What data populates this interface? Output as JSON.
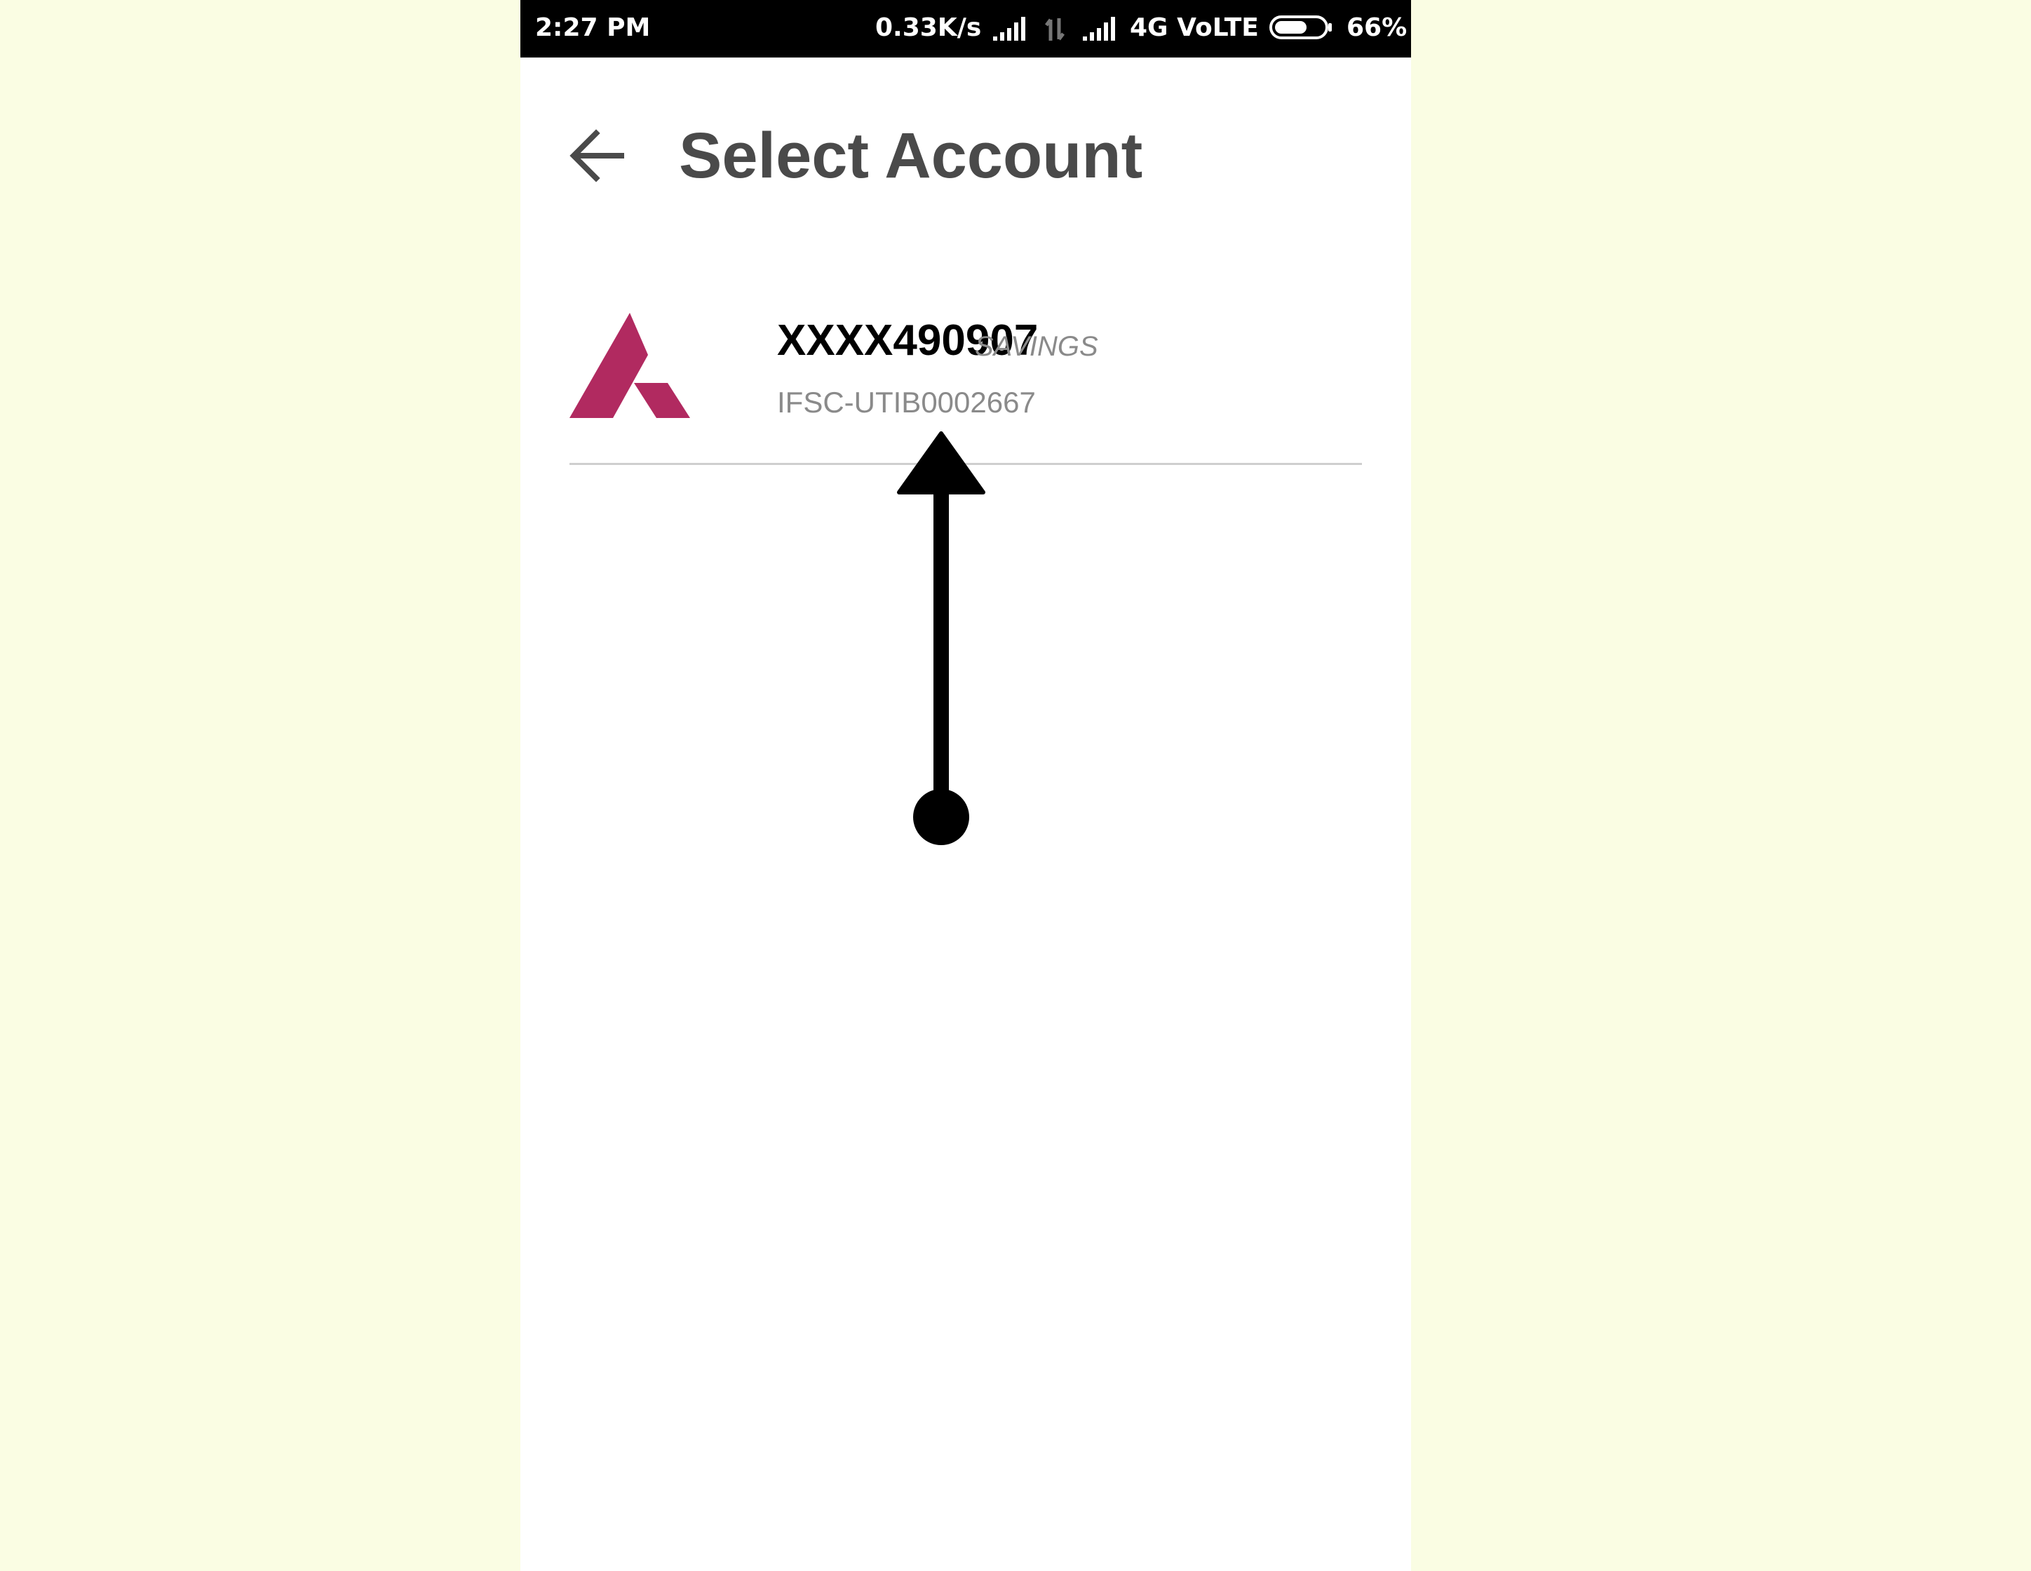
{
  "status_bar": {
    "time": "2:27 PM",
    "network_speed": "0.33K/s",
    "network_type": "4G VoLTE",
    "battery_percent": "66%",
    "battery_level": 0.66
  },
  "header": {
    "back_icon": "arrow-left-icon",
    "title": "Select Account"
  },
  "accounts": [
    {
      "bank_logo_icon": "axis-bank-logo",
      "number": "XXXX490907",
      "type": "SAVINGS",
      "ifsc": "IFSC-UTIB0002667"
    }
  ],
  "colors": {
    "page_background": "#fafde3",
    "status_bar_background": "#000000",
    "title_color": "#4a4a4a",
    "secondary_text": "#8a8a8a",
    "logo_color": "#b12a60",
    "gesture_overlay": "#000000"
  },
  "gesture_overlay": {
    "type": "swipe-up",
    "icon": "swipe-up-arrow-icon"
  }
}
